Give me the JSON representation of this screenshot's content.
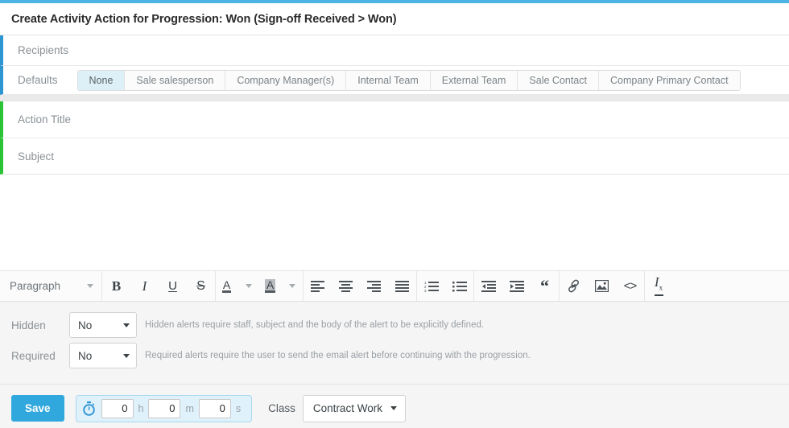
{
  "theme": {
    "accent_blue": "#4cb3e4",
    "rail_blue": "#2e95d3",
    "rail_green": "#2bc336",
    "active_tab_bg": "#ddeff7",
    "save_button_bg": "#31a8dd",
    "timer_bg": "#dff1fb"
  },
  "header": {
    "title": "Create Activity Action for Progression: Won (Sign-off Received > Won)"
  },
  "recipients": {
    "label": "Recipients",
    "defaults_label": "Defaults",
    "tabs": [
      {
        "label": "None",
        "active": true
      },
      {
        "label": "Sale salesperson",
        "active": false
      },
      {
        "label": "Company Manager(s)",
        "active": false
      },
      {
        "label": "Internal Team",
        "active": false
      },
      {
        "label": "External Team",
        "active": false
      },
      {
        "label": "Sale Contact",
        "active": false
      },
      {
        "label": "Company Primary Contact",
        "active": false
      }
    ]
  },
  "fields": {
    "action_title_placeholder": "Action Title",
    "action_title_value": "",
    "subject_placeholder": "Subject",
    "subject_value": "",
    "body_value": ""
  },
  "toolbar": {
    "paragraph_label": "Paragraph",
    "buttons": [
      {
        "name": "bold-icon",
        "glyph": "B"
      },
      {
        "name": "italic-icon",
        "glyph": "I"
      },
      {
        "name": "underline-icon",
        "glyph": "U"
      },
      {
        "name": "strikethrough-icon",
        "glyph": "S"
      },
      {
        "name": "font-color-icon",
        "glyph": "A"
      },
      {
        "name": "highlight-color-icon",
        "glyph": "A"
      },
      {
        "name": "align-left-icon",
        "glyph": ""
      },
      {
        "name": "align-center-icon",
        "glyph": ""
      },
      {
        "name": "align-right-icon",
        "glyph": ""
      },
      {
        "name": "align-justify-icon",
        "glyph": ""
      },
      {
        "name": "ordered-list-icon",
        "glyph": ""
      },
      {
        "name": "bullet-list-icon",
        "glyph": ""
      },
      {
        "name": "outdent-icon",
        "glyph": ""
      },
      {
        "name": "indent-icon",
        "glyph": ""
      },
      {
        "name": "blockquote-icon",
        "glyph": "“"
      },
      {
        "name": "link-icon",
        "glyph": ""
      },
      {
        "name": "image-icon",
        "glyph": ""
      },
      {
        "name": "source-code-icon",
        "glyph": "<>"
      },
      {
        "name": "clear-formatting-icon",
        "glyph": "Tx"
      }
    ]
  },
  "options": {
    "hidden": {
      "label": "Hidden",
      "value": "No",
      "help": "Hidden alerts require staff, subject and the body of the alert to be explicitly defined."
    },
    "required": {
      "label": "Required",
      "value": "No",
      "help": "Required alerts require the user to send the email alert before continuing with the progression."
    }
  },
  "footer": {
    "save_label": "Save",
    "timer": {
      "hours": "0",
      "hours_unit": "h",
      "minutes": "0",
      "minutes_unit": "m",
      "seconds": "0",
      "seconds_unit": "s"
    },
    "class_label": "Class",
    "class_value": "Contract Work"
  }
}
